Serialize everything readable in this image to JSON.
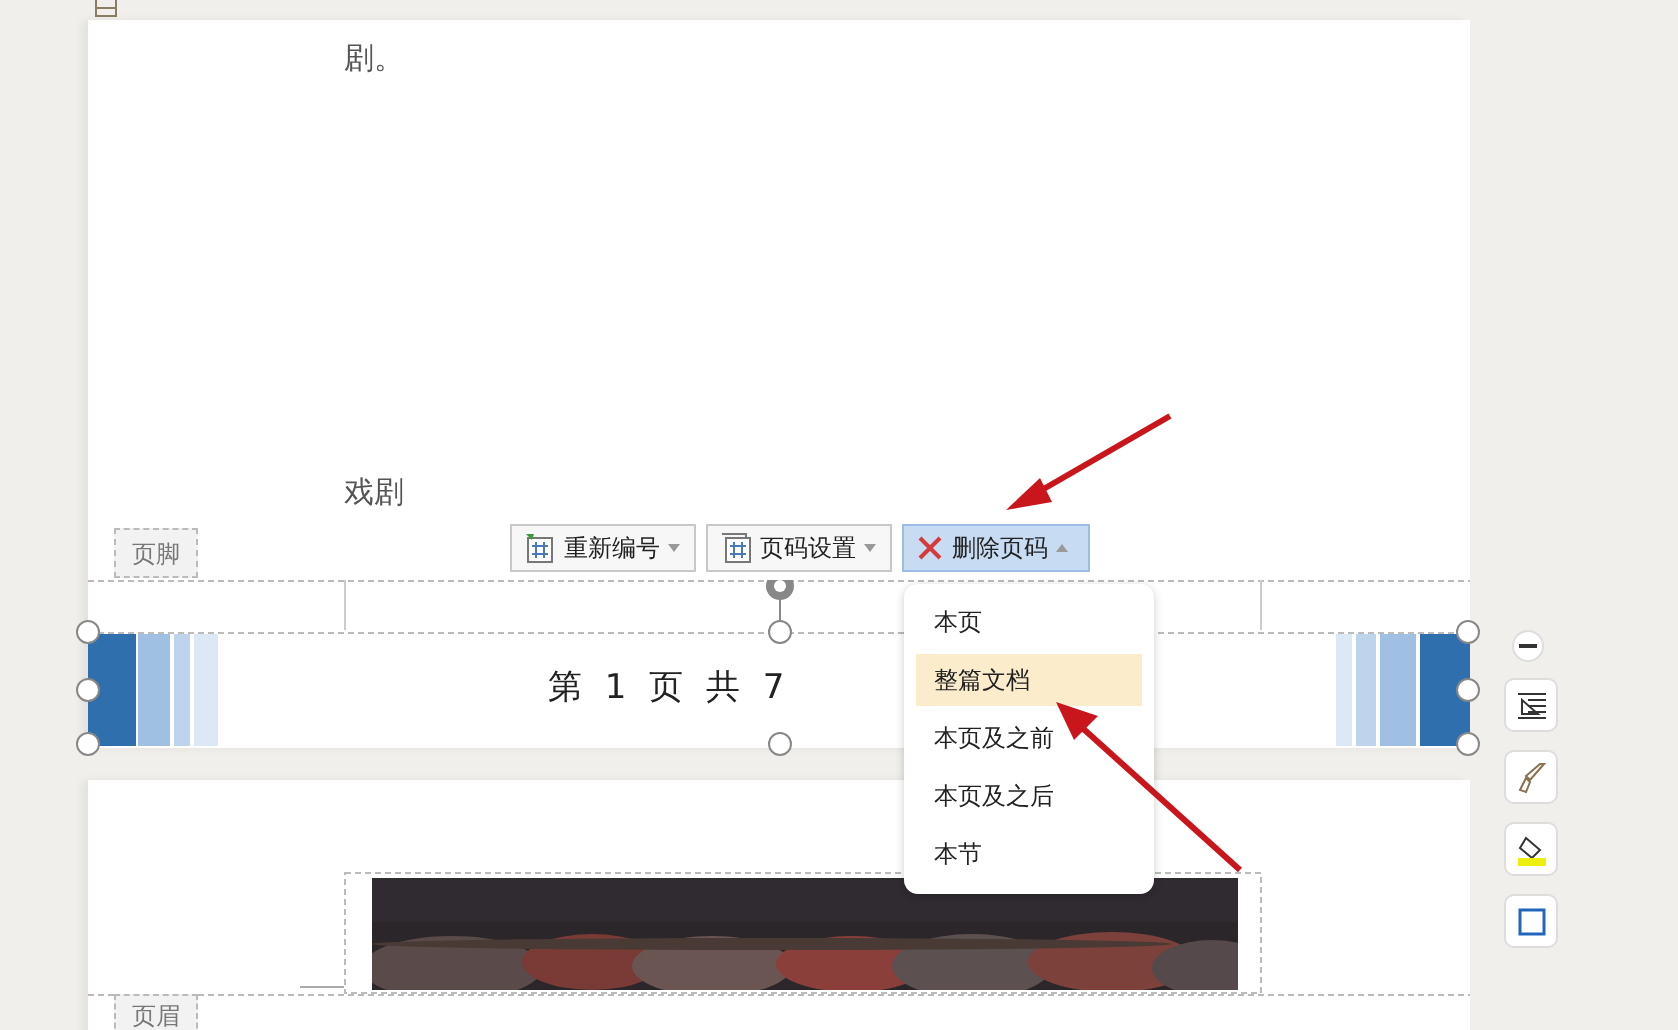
{
  "body_texts": [
    "剧。",
    "戏剧"
  ],
  "footer_label": "页脚",
  "footer_toolbar": [
    {
      "label": "重新编号",
      "kind": "renumber",
      "open": false
    },
    {
      "label": "页码设置",
      "kind": "settings",
      "open": false
    },
    {
      "label": "删除页码",
      "kind": "delete",
      "open": true
    }
  ],
  "dropdown": [
    {
      "label": "本页",
      "selected": false
    },
    {
      "label": "整篇文档",
      "selected": true
    },
    {
      "label": "本页及之前",
      "selected": false
    },
    {
      "label": "本页及之后",
      "selected": false
    },
    {
      "label": "本节",
      "selected": false
    }
  ],
  "page_number_text": "第 1 页 共 7",
  "header_label": "页眉",
  "side_tools": [
    {
      "kind": "indent"
    },
    {
      "kind": "brush"
    },
    {
      "kind": "fill"
    },
    {
      "kind": "frame"
    }
  ]
}
